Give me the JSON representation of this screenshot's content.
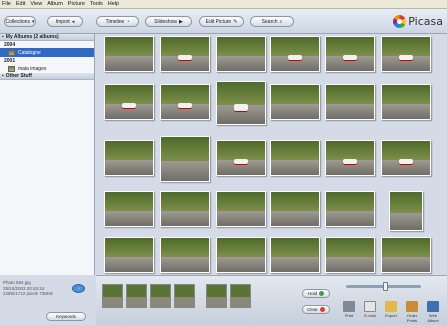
{
  "menu": [
    "File",
    "Edit",
    "View",
    "Album",
    "Picture",
    "Tools",
    "Help"
  ],
  "toolbar": {
    "collections": "Collections",
    "import": "Import",
    "timeline": "Timeline",
    "slideshow": "Slideshow",
    "edit_picture": "Edit Picture",
    "search": "Search"
  },
  "app_name": "Picasa",
  "sidebar": {
    "my_albums": "My Albums (2 albums)",
    "year_2004": "2004",
    "album_1": "Catalogne",
    "year_2001": "2001",
    "album_2": "maia images",
    "other_stuff": "Other Stuff"
  },
  "info": {
    "line1": "Photo 584.jpg",
    "line2": "28/10/2003 20:45:24",
    "line3": "2288x1712 pixels   738KB"
  },
  "keywords_btn": "Keywords",
  "bottom": {
    "hold": "Hold",
    "clear": "Clear",
    "actions": [
      "Print",
      "E-mail",
      "Export",
      "Order Prints",
      "Web Album"
    ]
  },
  "colors": {
    "selection": "#316ac5",
    "panel": "#d4dbe6"
  }
}
